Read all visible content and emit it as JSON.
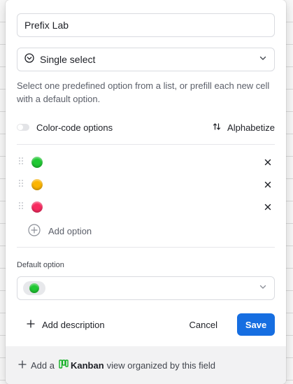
{
  "field": {
    "name_value": "Prefix Lab",
    "type_label": "Single select",
    "description": "Select one predefined option from a list, or prefill each new cell with a default option."
  },
  "options_header": {
    "color_code_label": "Color-code options",
    "alphabetize_label": "Alphabetize",
    "color_code_enabled": false
  },
  "options": [
    {
      "color": "#20c933",
      "label": ""
    },
    {
      "color": "#fcb400",
      "label": ""
    },
    {
      "color": "#f82b60",
      "label": ""
    }
  ],
  "add_option_label": "Add option",
  "default_option": {
    "label": "Default option",
    "selected_color": "#20c933"
  },
  "footer": {
    "add_description_label": "Add description",
    "cancel_label": "Cancel",
    "save_label": "Save"
  },
  "kanban_hint": {
    "prefix": "Add a",
    "view_name": "Kanban",
    "suffix": "view organized by this field",
    "icon_color": "#11af22"
  },
  "colors": {
    "accent": "#166ee1"
  }
}
